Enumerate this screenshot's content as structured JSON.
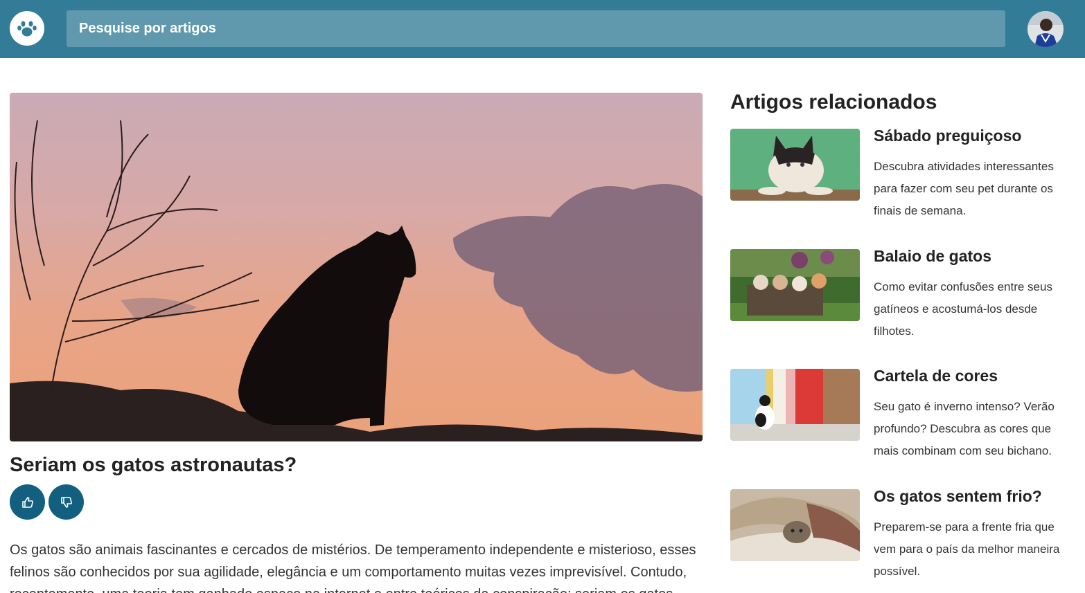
{
  "header": {
    "logo_icon": "paw-icon",
    "search_placeholder": "Pesquise por artigos",
    "avatar_icon": "user-avatar",
    "bar_color": "#337c97",
    "search_color": "#6099ad"
  },
  "article": {
    "image_icon": "cat-silhouette-sunset-image",
    "title": "Seriam os gatos astronautas?",
    "like_icon": "thumbs-up-icon",
    "dislike_icon": "thumbs-down-icon",
    "vote_button_color": "#125f80",
    "body": "Os gatos são animais fascinantes e cercados de mistérios. De temperamento independente e misterioso, esses felinos são conhecidos por sua agilidade, elegância e um comportamento muitas vezes imprevisível. Contudo, recentemente, uma teoria tem ganhado espaço na internet e entre teóricos da conspiração: seriam os gatos"
  },
  "related": {
    "heading": "Artigos relacionados",
    "items": [
      {
        "title": "Sábado preguiçoso",
        "description": "Descubra atividades interessantes para fazer com seu pet durante os finais de semana.",
        "image_icon": "cat-on-green-wall-image"
      },
      {
        "title": "Balaio de gatos",
        "description": "Como evitar confusões entre seus gatíneos e acostumá-los desde filhotes.",
        "image_icon": "kittens-in-basket-image"
      },
      {
        "title": "Cartela de cores",
        "description": "Seu gato é inverno intenso? Verão profundo? Descubra as cores que mais combinam com seu bichano.",
        "image_icon": "cat-by-colorful-wall-image"
      },
      {
        "title": "Os gatos sentem frio?",
        "description": "Preparem-se para a frente fria que vem para o país da melhor maneira possível.",
        "image_icon": "cat-under-blanket-image"
      }
    ]
  }
}
